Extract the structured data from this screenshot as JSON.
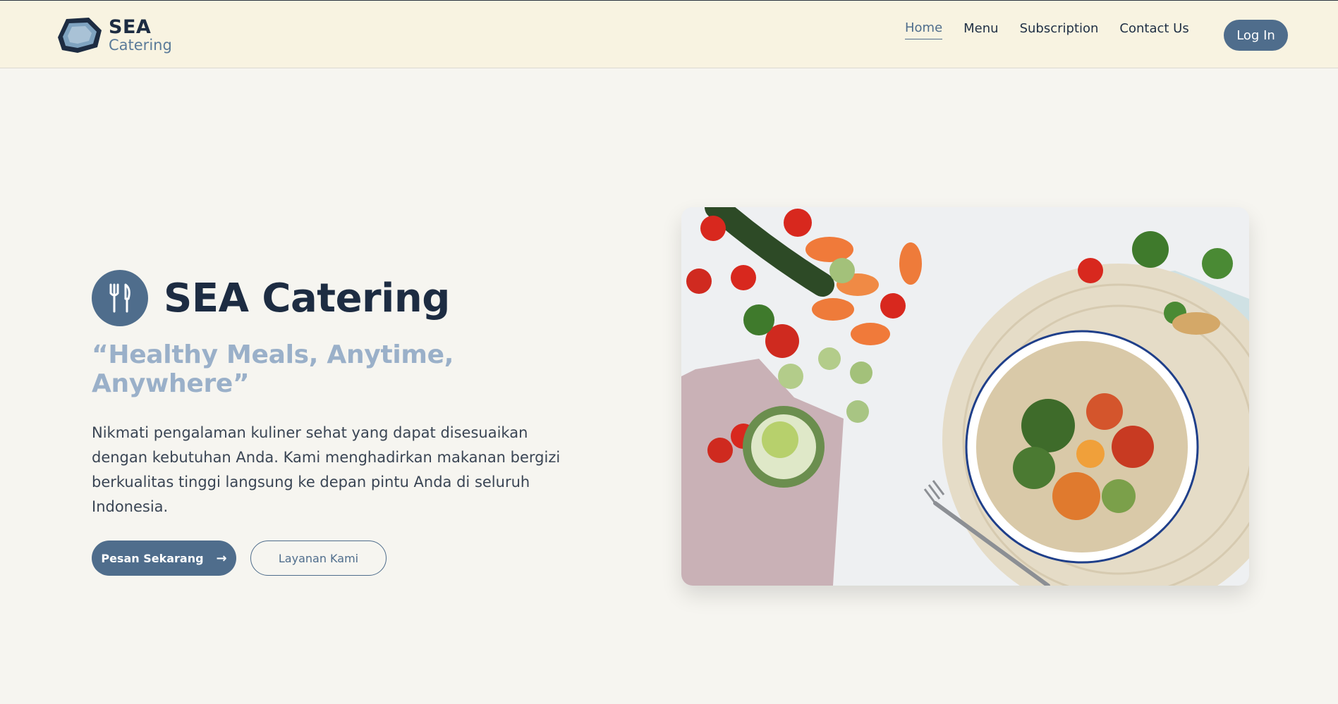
{
  "brand": {
    "line1": "SEA",
    "line2": "Catering"
  },
  "nav": {
    "items": [
      {
        "label": "Home",
        "active": true
      },
      {
        "label": "Menu"
      },
      {
        "label": "Subscription"
      },
      {
        "label": "Contact Us"
      }
    ],
    "login_label": "Log In"
  },
  "hero": {
    "title": "SEA Catering",
    "tagline": "“Healthy Meals, Anytime, Anywhere”",
    "description": "Nikmati pengalaman kuliner sehat yang dapat disesuaikan dengan kebutuhan Anda. Kami menghadirkan makanan bergizi berkualitas tinggi langsung ke depan pintu Anda di seluruh Indonesia.",
    "primary_button": "Pesan Sekarang",
    "secondary_button": "Layanan Kami",
    "icons": {
      "badge": "fork-knife-icon",
      "arrow": "arrow-right-icon"
    }
  },
  "colors": {
    "accent": "#4f6d8c",
    "header_bg": "#f8f3e1",
    "page_bg": "#f6f5f0",
    "title": "#1d2c42",
    "tagline": "#9ab0c9"
  }
}
